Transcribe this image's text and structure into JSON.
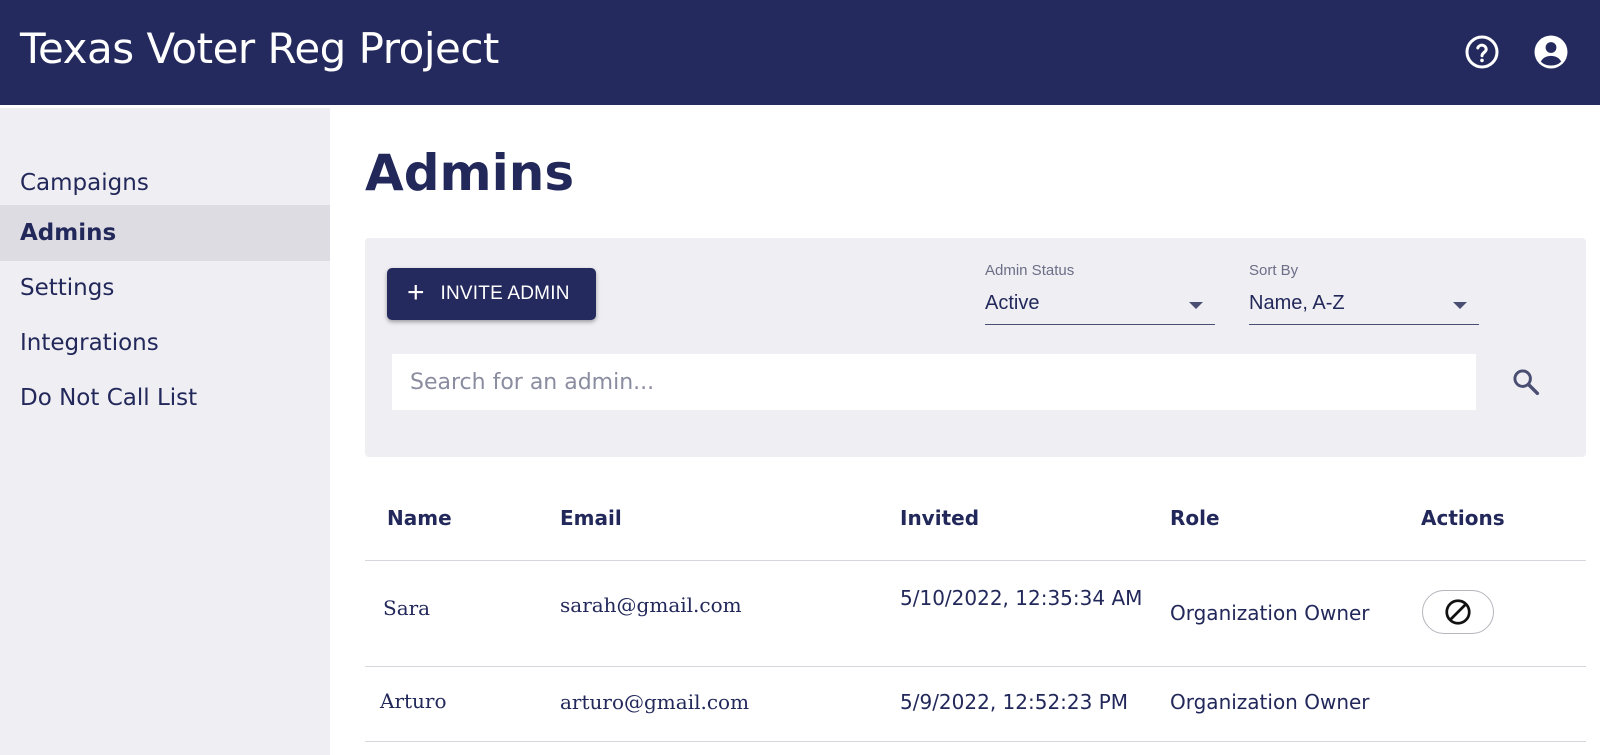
{
  "header": {
    "title": "Texas Voter Reg Project",
    "icons": [
      "help-circle-icon",
      "account-circle-icon"
    ]
  },
  "sidebar": {
    "items": [
      {
        "label": "Campaigns",
        "active": false
      },
      {
        "label": "Admins",
        "active": true
      },
      {
        "label": "Settings",
        "active": false
      },
      {
        "label": "Integrations",
        "active": false
      },
      {
        "label": "Do Not Call List",
        "active": false
      }
    ]
  },
  "main": {
    "title": "Admins",
    "invite_button": {
      "label": "INVITE ADMIN",
      "icon": "plus-icon"
    },
    "filters": {
      "status": {
        "caption": "Admin Status",
        "value": "Active"
      },
      "sort": {
        "caption": "Sort By",
        "value": "Name, A-Z"
      }
    },
    "search": {
      "placeholder": "Search for an admin...",
      "value": "",
      "icon": "search-icon"
    },
    "table": {
      "columns": [
        "Name",
        "Email",
        "Invited",
        "Role",
        "Actions"
      ],
      "rows": [
        {
          "name": "Sara",
          "email": "sarah@gmail.com",
          "invited": "5/10/2022, 12:35:34 AM",
          "role": "Organization Owner",
          "action": "deactivate-icon"
        },
        {
          "name": "Arturo",
          "email": "arturo@gmail.com",
          "invited": "5/9/2022, 12:52:23 PM",
          "role": "Organization Owner",
          "action": null
        }
      ]
    }
  },
  "colors": {
    "brand": "#242a5e",
    "panel": "#efeef3",
    "active_nav": "#dddce2",
    "text": "#22285a"
  }
}
